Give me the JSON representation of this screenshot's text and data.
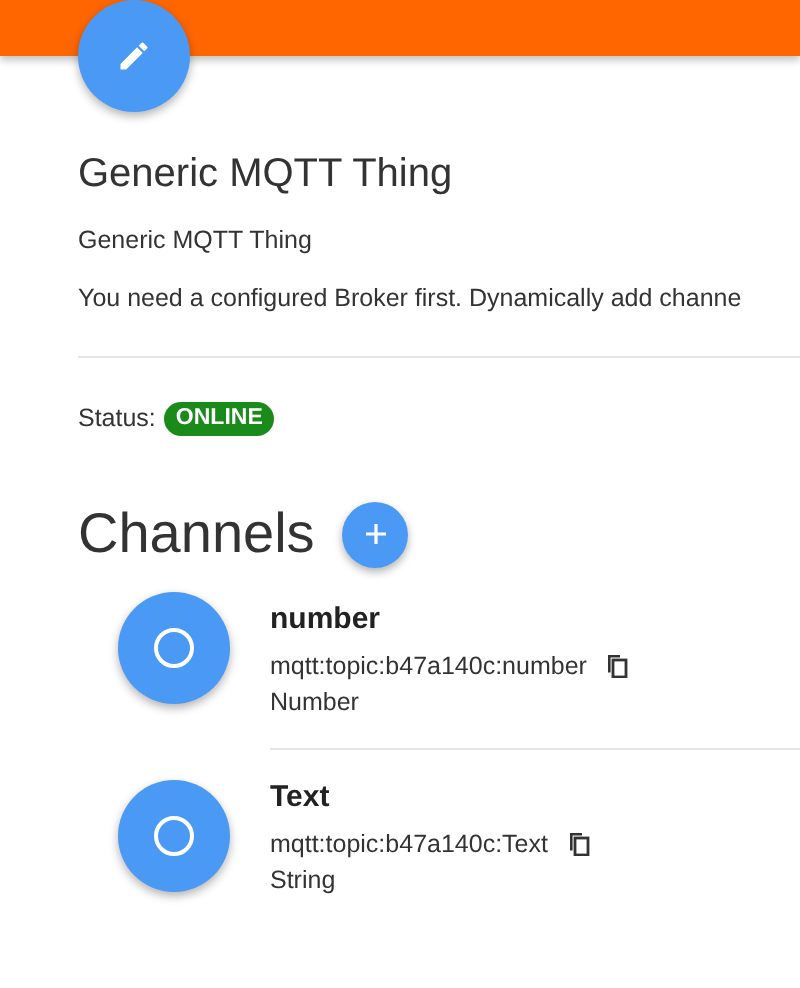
{
  "thing": {
    "title": "Generic MQTT Thing",
    "label": "Generic MQTT Thing",
    "description": "You need a configured Broker first. Dynamically add channe"
  },
  "status": {
    "label": "Status:",
    "badge": "ONLINE",
    "kind": "online"
  },
  "channels_heading": "Channels",
  "channels": [
    {
      "name": "number",
      "uid": "mqtt:topic:b47a140c:number",
      "type": "Number"
    },
    {
      "name": "Text",
      "uid": "mqtt:topic:b47a140c:Text",
      "type": "String"
    }
  ]
}
